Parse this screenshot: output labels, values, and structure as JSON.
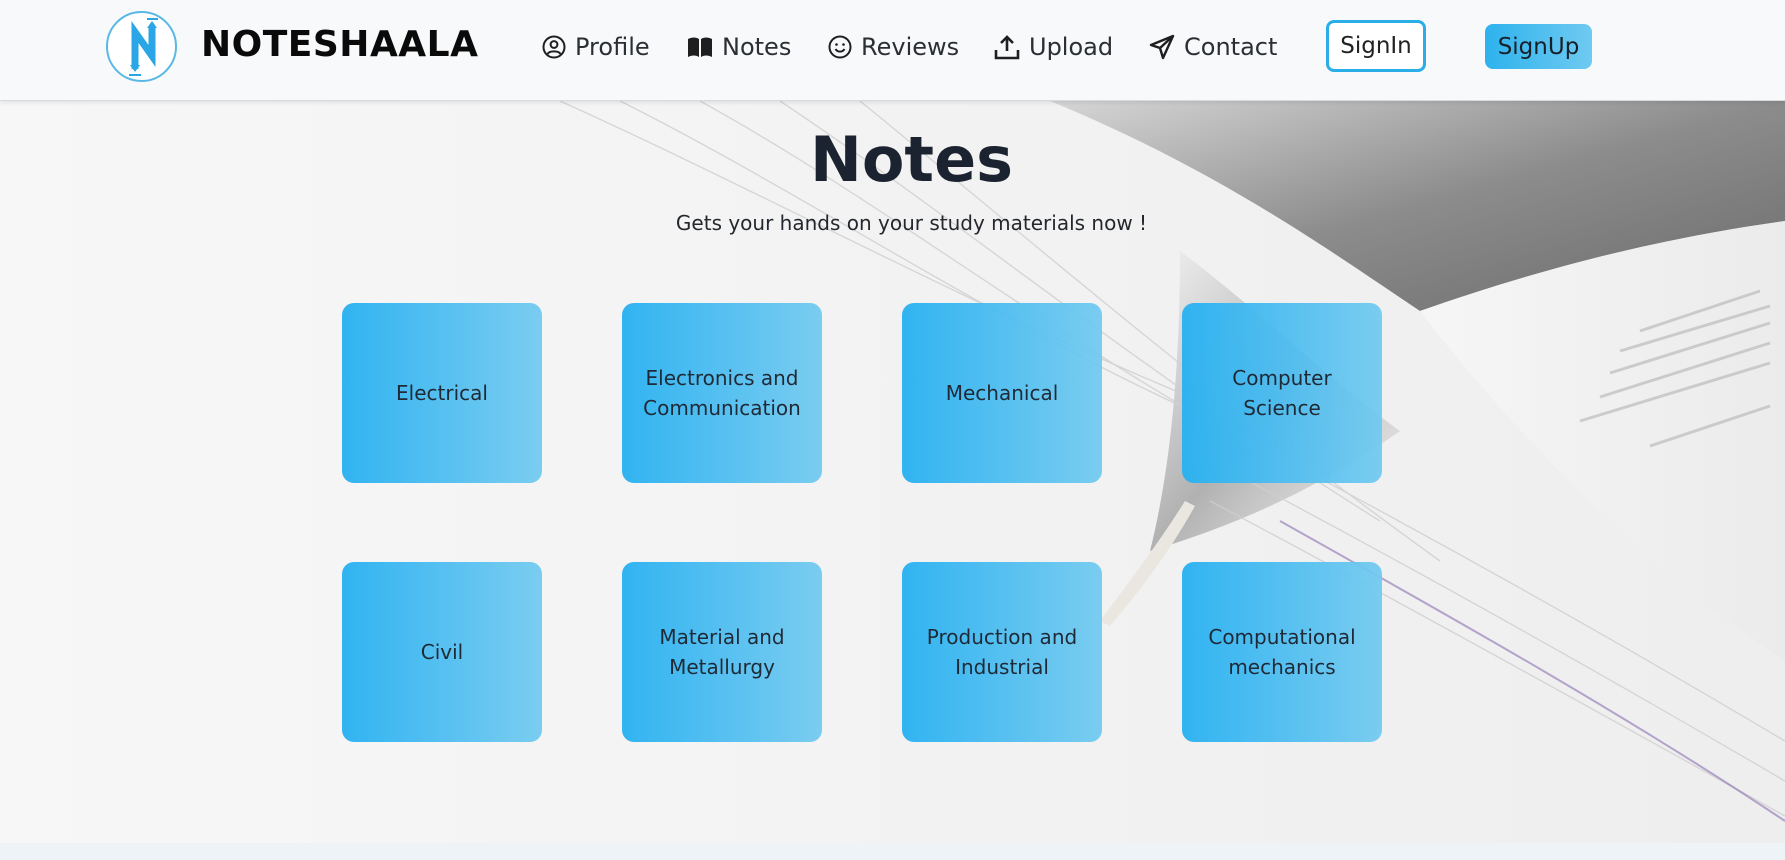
{
  "brand": {
    "name": "NOTESHAALA",
    "logo_icon": "n-arrows-logo-icon"
  },
  "nav": {
    "items": [
      {
        "label": "Profile",
        "icon": "user-circle-icon"
      },
      {
        "label": "Notes",
        "icon": "open-book-icon"
      },
      {
        "label": "Reviews",
        "icon": "smile-icon"
      },
      {
        "label": "Upload",
        "icon": "upload-icon"
      },
      {
        "label": "Contact",
        "icon": "paper-plane-icon"
      }
    ],
    "signin_label": "SignIn",
    "signup_label": "SignUp"
  },
  "hero": {
    "title": "Notes",
    "subtitle": "Gets your hands on your study materials now !"
  },
  "categories": [
    "Electrical",
    "Electronics and Communication",
    "Mechanical",
    "Computer Science",
    "Civil",
    "Material and Metallurgy",
    "Production and Industrial",
    "Computational mechanics"
  ],
  "colors": {
    "accent": "#2eb2ed",
    "accent_light": "#70c9f0",
    "title": "#1c2330"
  }
}
